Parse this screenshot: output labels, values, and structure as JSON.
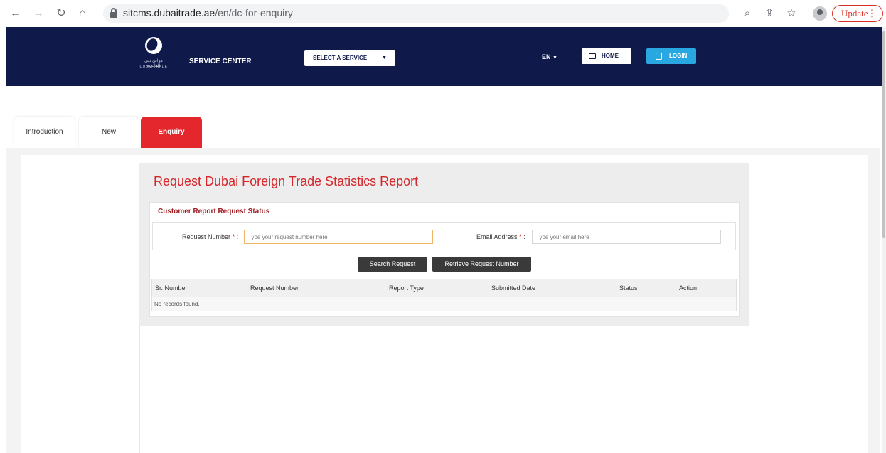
{
  "browser": {
    "url_host": "sitcms.dubaitrade.ae",
    "url_path": "/en/dc-for-enquiry",
    "update_label": "Update"
  },
  "header": {
    "logo_arabic": "موانئ دبي العالمية",
    "logo_text": "DUBAI TRADE",
    "service_center": "SERVICE CENTER",
    "select_service": "SELECT A SERVICE",
    "language": "EN",
    "home": "HOME",
    "login": "LOGIN",
    "bg_color": "#101a4a",
    "login_color": "#29a7e1"
  },
  "tabs": [
    {
      "label": "Introduction",
      "active": false
    },
    {
      "label": "New",
      "active": false
    },
    {
      "label": "Enquiry",
      "active": true
    }
  ],
  "form": {
    "title": "Request Dubai Foreign Trade Statistics Report",
    "section_title": "Customer Report Request Status",
    "request_number_label": "Request Number",
    "request_number_placeholder": "Type your request number here",
    "email_label": "Email Address",
    "email_placeholder": "Type your email here",
    "required_mark": "*",
    "colon": ":",
    "search_button": "Search Request",
    "retrieve_button": "Retrieve Request Number",
    "accent_color": "#e3272d"
  },
  "table": {
    "columns": [
      "Sr. Number",
      "Request Number",
      "Report Type",
      "Submitted Date",
      "Status",
      "Action"
    ],
    "empty_message": "No records found."
  }
}
